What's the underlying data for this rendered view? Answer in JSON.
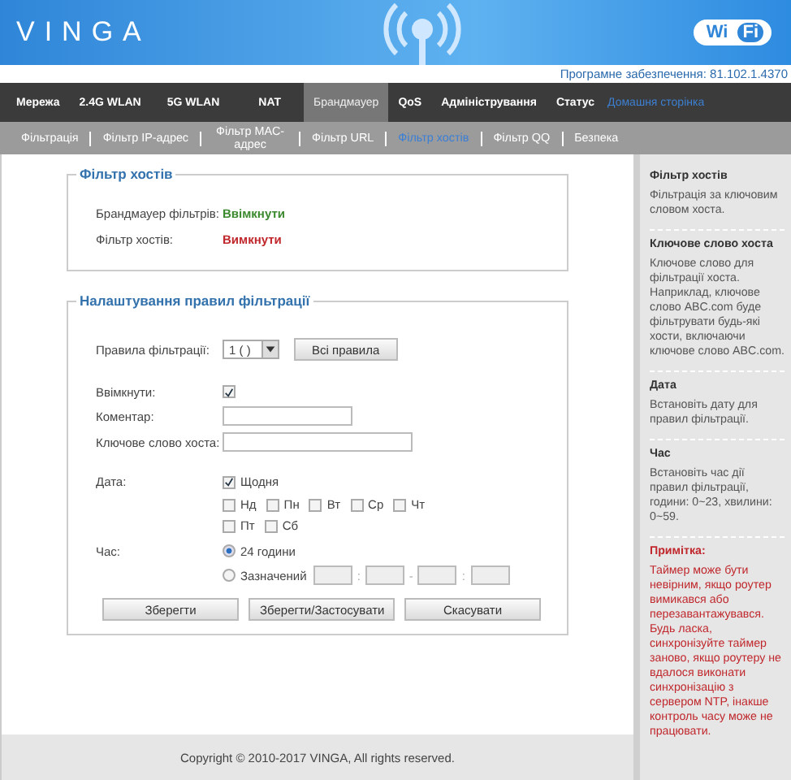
{
  "header": {
    "logo": "VINGA",
    "badge": [
      "Wi",
      "Fi"
    ]
  },
  "firmware": "Програмне забезпечення: 81.102.1.4370",
  "nav": [
    {
      "label": "Мережа",
      "selected": false,
      "kind": "tab"
    },
    {
      "label": "2.4G WLAN",
      "selected": false,
      "kind": "tab"
    },
    {
      "label": "5G WLAN",
      "selected": false,
      "kind": "tab"
    },
    {
      "label": "NAT",
      "selected": false,
      "kind": "tab"
    },
    {
      "label": "Брандмауер",
      "selected": true,
      "kind": "tab"
    },
    {
      "label": "QoS",
      "selected": false,
      "kind": "tab"
    },
    {
      "label": "Адміністрування",
      "selected": false,
      "kind": "tab"
    },
    {
      "label": "Статус",
      "selected": false,
      "kind": "tab"
    },
    {
      "label": "Домашня сторінка",
      "selected": false,
      "kind": "link"
    }
  ],
  "subnav": [
    {
      "label": "Фільтрація",
      "selected": false
    },
    {
      "label": "Фільтр IP-адрес",
      "selected": false
    },
    {
      "label": "Фільтр MAC-адрес",
      "selected": false
    },
    {
      "label": "Фільтр URL",
      "selected": false
    },
    {
      "label": "Фільтр хостів",
      "selected": true
    },
    {
      "label": "Фільтр QQ",
      "selected": false
    },
    {
      "label": "Безпека",
      "selected": false
    }
  ],
  "status_box": {
    "title": "Фільтр хостів",
    "rows": [
      {
        "label": "Брандмауер фільтрів:",
        "value": "Ввімкнути",
        "on": true
      },
      {
        "label": "Фільтр хостів:",
        "value": "Вимкнути",
        "on": false
      }
    ]
  },
  "rules": {
    "title": "Налаштування правил фільтрації",
    "rule": {
      "label": "Правила фільтрації:",
      "value": "1 ( )",
      "button": "Всі правила"
    },
    "enable": {
      "label": "Ввімкнути:",
      "checked": true
    },
    "comment": {
      "label": "Коментар:"
    },
    "keyword": {
      "label": "Ключове слово хоста:"
    },
    "date": {
      "label": "Дата:",
      "everyday": {
        "label": "Щодня",
        "checked": true
      },
      "days": [
        {
          "label": "Нд",
          "checked": false
        },
        {
          "label": "Пн",
          "checked": false
        },
        {
          "label": "Вт",
          "checked": false
        },
        {
          "label": "Ср",
          "checked": false
        },
        {
          "label": "Чт",
          "checked": false
        },
        {
          "label": "Пт",
          "checked": false
        },
        {
          "label": "Сб",
          "checked": false
        }
      ]
    },
    "time": {
      "label": "Час:",
      "options": [
        {
          "label": "24 години",
          "selected": true
        },
        {
          "label": "Зазначений",
          "selected": false
        }
      ],
      "separators": [
        ":",
        "-",
        ":"
      ]
    },
    "buttons": [
      "Зберегти",
      "Зберегти/Застосувати",
      "Скасувати"
    ]
  },
  "footer": "Copyright © 2010-2017 VINGA, All rights reserved.",
  "help": {
    "sections": [
      {
        "title": "Фільтр хостів",
        "text": "Фільтрація за ключовим словом хоста."
      },
      {
        "title": "Ключове слово хоста",
        "text": "Ключове слово для фільтрації хоста. Наприклад, ключове слово ABC.com буде фільтрувати будь-які хости, включаючи ключове слово ABC.com."
      },
      {
        "title": "Дата",
        "text": "Встановіть дату для правил фільтрації."
      },
      {
        "title": "Час",
        "text": "Встановіть час дії правил фільтрації, години: 0~23, хвилини: 0~59."
      }
    ],
    "note": {
      "title": "Примітка:",
      "text": "Таймер може бути невірним, якщо роутер вимикався або перезавантажувався. Будь ласка, синхронізуйте таймер заново, якщо роутеру не вдалося виконати синхронізацію з сервером NTP, інакше контроль часу може не працювати."
    }
  }
}
